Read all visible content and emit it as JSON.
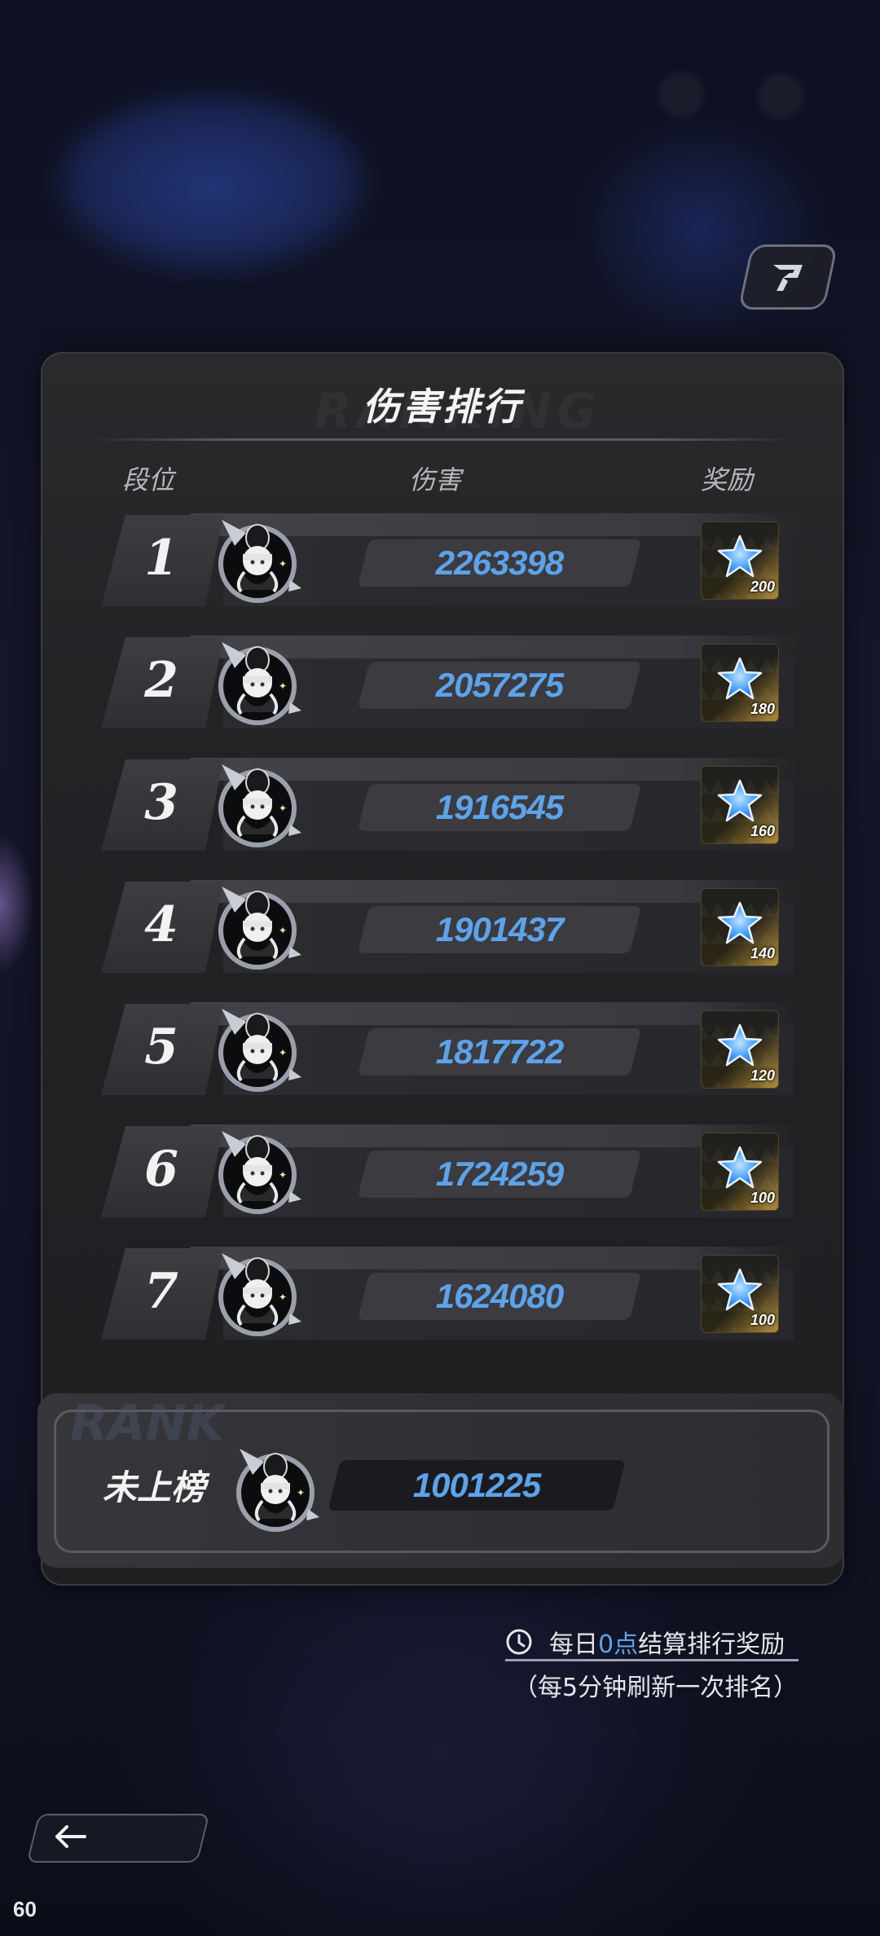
{
  "panel": {
    "title": "伤害排行",
    "headers": {
      "rank": "段位",
      "damage": "伤害",
      "reward": "奖励"
    }
  },
  "rows": [
    {
      "rank": "1",
      "damage": "2263398",
      "reward": "200"
    },
    {
      "rank": "2",
      "damage": "2057275",
      "reward": "180"
    },
    {
      "rank": "3",
      "damage": "1916545",
      "reward": "160"
    },
    {
      "rank": "4",
      "damage": "1901437",
      "reward": "140"
    },
    {
      "rank": "5",
      "damage": "1817722",
      "reward": "120"
    },
    {
      "rank": "6",
      "damage": "1724259",
      "reward": "100"
    },
    {
      "rank": "7",
      "damage": "1624080",
      "reward": "100"
    }
  ],
  "self": {
    "label": "未上榜",
    "damage": "1001225"
  },
  "notes": {
    "settle_prefix": "每日",
    "settle_highlight": "0点",
    "settle_suffix": "结算排行奖励",
    "refresh": "（每5分钟刷新一次排名）"
  },
  "status": {
    "fps": "60"
  },
  "colors": {
    "damage_text": "#5da3ea",
    "reward_star": "#4aa3ff"
  },
  "icons": {
    "corner": "share-icon",
    "reward": "star-icon",
    "clock": "clock-icon",
    "back": "back-arrow-icon"
  }
}
